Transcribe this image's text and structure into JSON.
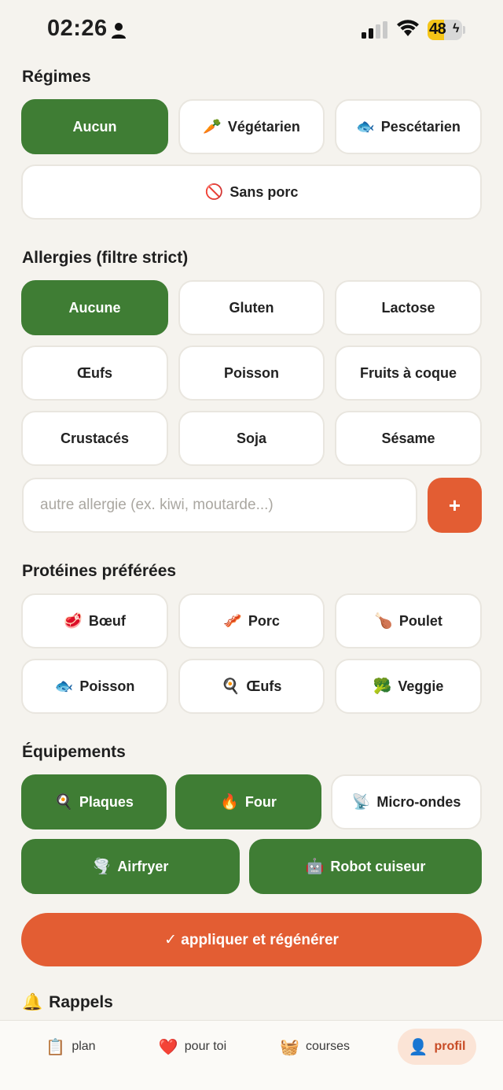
{
  "status": {
    "time": "02:26",
    "battery": "48",
    "battery_level": 0.48
  },
  "regimes": {
    "title": "Régimes",
    "items": [
      {
        "label": "Aucun",
        "icon": "",
        "selected": true
      },
      {
        "label": "Végétarien",
        "icon": "🥕",
        "selected": false
      },
      {
        "label": "Pescétarien",
        "icon": "🐟",
        "selected": false
      },
      {
        "label": "Sans porc",
        "icon": "🚫",
        "selected": false
      }
    ]
  },
  "allergies": {
    "title": "Allergies (filtre strict)",
    "items": [
      {
        "label": "Aucune",
        "selected": true
      },
      {
        "label": "Gluten",
        "selected": false
      },
      {
        "label": "Lactose",
        "selected": false
      },
      {
        "label": "Œufs",
        "selected": false
      },
      {
        "label": "Poisson",
        "selected": false
      },
      {
        "label": "Fruits à coque",
        "selected": false
      },
      {
        "label": "Crustacés",
        "selected": false
      },
      {
        "label": "Soja",
        "selected": false
      },
      {
        "label": "Sésame",
        "selected": false
      }
    ],
    "input_placeholder": "autre allergie (ex. kiwi, moutarde...)",
    "add_label": "+"
  },
  "proteines": {
    "title": "Protéines préférées",
    "items": [
      {
        "label": "Bœuf",
        "icon": "🥩",
        "selected": false
      },
      {
        "label": "Porc",
        "icon": "🥓",
        "selected": false
      },
      {
        "label": "Poulet",
        "icon": "🍗",
        "selected": false
      },
      {
        "label": "Poisson",
        "icon": "🐟",
        "selected": false
      },
      {
        "label": "Œufs",
        "icon": "🍳",
        "selected": false
      },
      {
        "label": "Veggie",
        "icon": "🥦",
        "selected": false
      }
    ]
  },
  "equipements": {
    "title": "Équipements",
    "items": [
      {
        "label": "Plaques",
        "icon": "🍳",
        "selected": true
      },
      {
        "label": "Four",
        "icon": "🔥",
        "selected": true
      },
      {
        "label": "Micro-ondes",
        "icon": "📡",
        "selected": false
      },
      {
        "label": "Airfryer",
        "icon": "🌪️",
        "selected": true
      },
      {
        "label": "Robot cuiseur",
        "icon": "🤖",
        "selected": true
      }
    ]
  },
  "apply_label": "✓ appliquer et régénérer",
  "rappels": {
    "icon": "🔔",
    "title": "Rappels"
  },
  "tabs": [
    {
      "label": "plan",
      "icon": "📋",
      "active": false
    },
    {
      "label": "pour toi",
      "icon": "❤️",
      "active": false
    },
    {
      "label": "courses",
      "icon": "🧺",
      "active": false
    },
    {
      "label": "profil",
      "icon": "👤",
      "active": true
    }
  ]
}
